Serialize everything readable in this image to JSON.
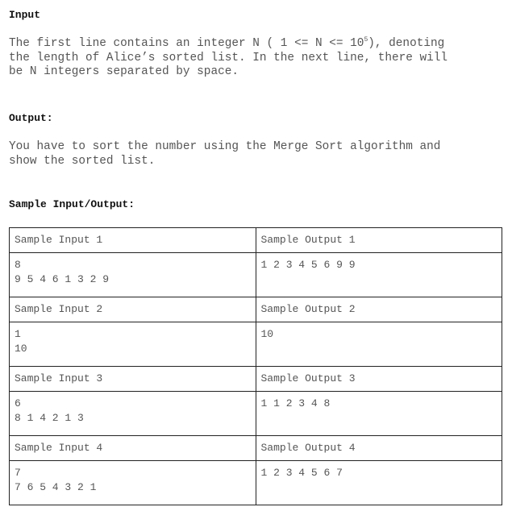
{
  "input": {
    "heading": "Input",
    "line1_pre": "The first line contains an integer N ( 1 <= N <= 10",
    "line1_sup": "5",
    "line1_post": "), denoting",
    "line2": "the length of Alice’s sorted list. In the next line, there will",
    "line3": "be N integers separated by space."
  },
  "output": {
    "heading": "Output:",
    "line1": "You have to sort the number using the Merge Sort algorithm and",
    "line2": "show the sorted list."
  },
  "samples": {
    "heading": "Sample Input/Output:",
    "rows": [
      {
        "input_label": "Sample Input 1",
        "output_label": "Sample Output 1",
        "input_lines": [
          "8",
          "9 5 4 6 1 3 2 9"
        ],
        "output": "1 2 3 4 5 6 9 9"
      },
      {
        "input_label": "Sample Input 2",
        "output_label": "Sample Output 2",
        "input_lines": [
          "1",
          "10"
        ],
        "output": "10"
      },
      {
        "input_label": "Sample Input 3",
        "output_label": "Sample Output 3",
        "input_lines": [
          "6",
          "8 1 4 2 1 3"
        ],
        "output": "1 1 2 3 4 8"
      },
      {
        "input_label": "Sample Input 4",
        "output_label": "Sample Output 4",
        "input_lines": [
          "7",
          "7 6 5 4 3 2 1"
        ],
        "output": "1 2 3 4 5 6 7"
      }
    ]
  }
}
